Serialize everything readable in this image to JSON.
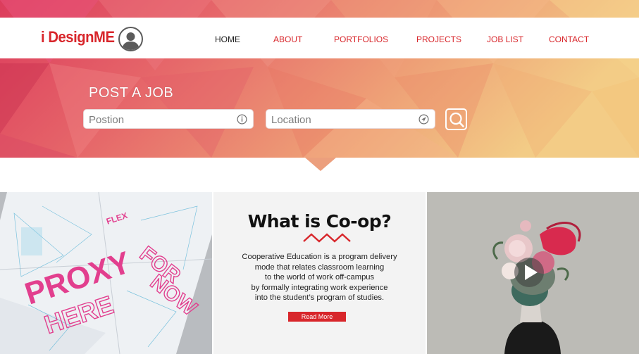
{
  "colors": {
    "brand": "#d8262b",
    "nav_active": "#222222",
    "nav_link": "#d8262b",
    "button_bg": "#d8262b",
    "poly_gradient": [
      "#e04563",
      "#ea7b6c",
      "#f0b27a",
      "#f2d38a"
    ]
  },
  "header": {
    "logo": "i DesignME",
    "avatar_icon": "user-avatar-icon",
    "nav": [
      {
        "label": "HOME",
        "active": true
      },
      {
        "label": "ABOUT",
        "active": false
      },
      {
        "label": "PORTFOLIOS",
        "active": false
      },
      {
        "label": "PROJECTS",
        "active": false
      },
      {
        "label": "JOB LIST",
        "active": false
      },
      {
        "label": "CONTACT",
        "active": false
      }
    ]
  },
  "search": {
    "title": "POST A JOB",
    "position_placeholder": "Postion",
    "position_icon": "info-icon",
    "location_placeholder": "Location",
    "location_icon": "location-arrow-icon",
    "button_icon": "search-icon"
  },
  "features": {
    "left_image": "proxy-poster-image",
    "mid": {
      "title": "What is Co-op?",
      "lines": [
        "Cooperative Education is a program delivery",
        "mode that relates classroom learning",
        "to the world of work off-campus",
        "by formally integrating work experience",
        "into the student’s program of studies."
      ],
      "button": "Read More"
    },
    "right_image": "floral-portrait-image",
    "play_icon": "play-icon"
  }
}
